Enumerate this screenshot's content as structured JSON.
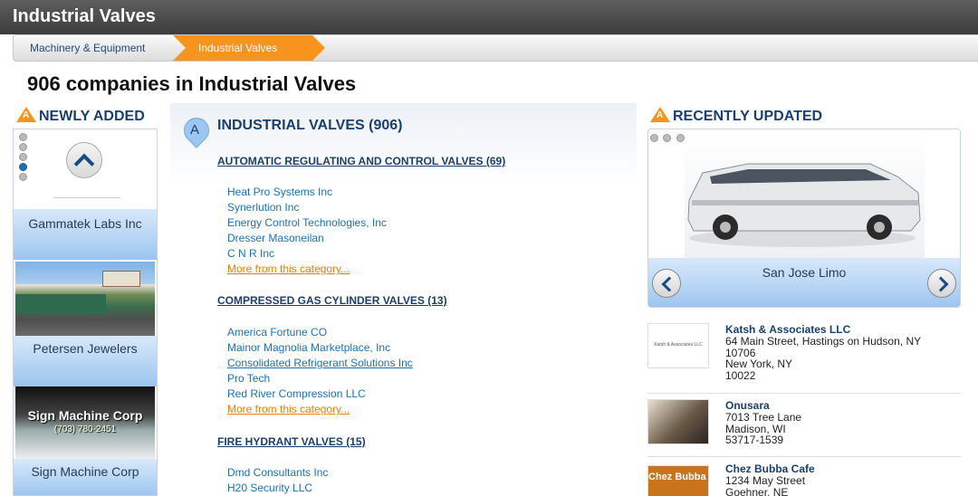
{
  "page": {
    "title": "Industrial Valves",
    "heading": "906 companies in Industrial Valves"
  },
  "breadcrumb": {
    "items": [
      "Machinery & Equipment",
      "Industrial Valves"
    ]
  },
  "newly_added": {
    "title": "NEWLY ADDED",
    "cards": [
      {
        "name": "Gammatek Labs Inc"
      },
      {
        "name": "Petersen Jewelers"
      },
      {
        "name": "Sign Machine Corp",
        "image_text": "Sign Machine Corp",
        "image_phone": "(703) 780-2451"
      }
    ]
  },
  "directory": {
    "letter": "A",
    "title": "INDUSTRIAL VALVES (906)",
    "more_label": "More from this category...",
    "categories": [
      {
        "title": "AUTOMATIC REGULATING AND CONTROL VALVES (69)",
        "companies": [
          "Heat Pro Systems Inc",
          "Synerlution Inc",
          "Energy Control Technologies, Inc",
          "Dresser Masoneilan",
          "C N R Inc"
        ]
      },
      {
        "title": "COMPRESSED GAS CYLINDER VALVES (13)",
        "companies": [
          "America Fortune CO",
          "Mainor Magnolia Marketplace, Inc",
          "Consolidated Refrigerant Solutions Inc",
          "Pro Tech",
          "Red River Compression LLC"
        ]
      },
      {
        "title": "FIRE HYDRANT VALVES (15)",
        "companies": [
          "Dmd Consultants Inc",
          "H20 Security LLC"
        ]
      }
    ]
  },
  "recently_updated": {
    "title": "RECENTLY UPDATED",
    "featured": "San Jose Limo",
    "listings": [
      {
        "name": "Katsh & Associates LLC",
        "address": [
          "64 Main Street, Hastings on Hudson, NY",
          "10706",
          "New York, NY",
          "10022"
        ],
        "thumb_text": "Katsh & Associates LLC"
      },
      {
        "name": "Onusara",
        "address": [
          "7013 Tree Lane",
          "Madison, WI",
          "53717-1539"
        ]
      },
      {
        "name": "Chez Bubba Cafe",
        "address": [
          "1234 May Street",
          "Goehner, NE"
        ],
        "thumb_text": "Chez Bubba Cafe"
      }
    ]
  }
}
